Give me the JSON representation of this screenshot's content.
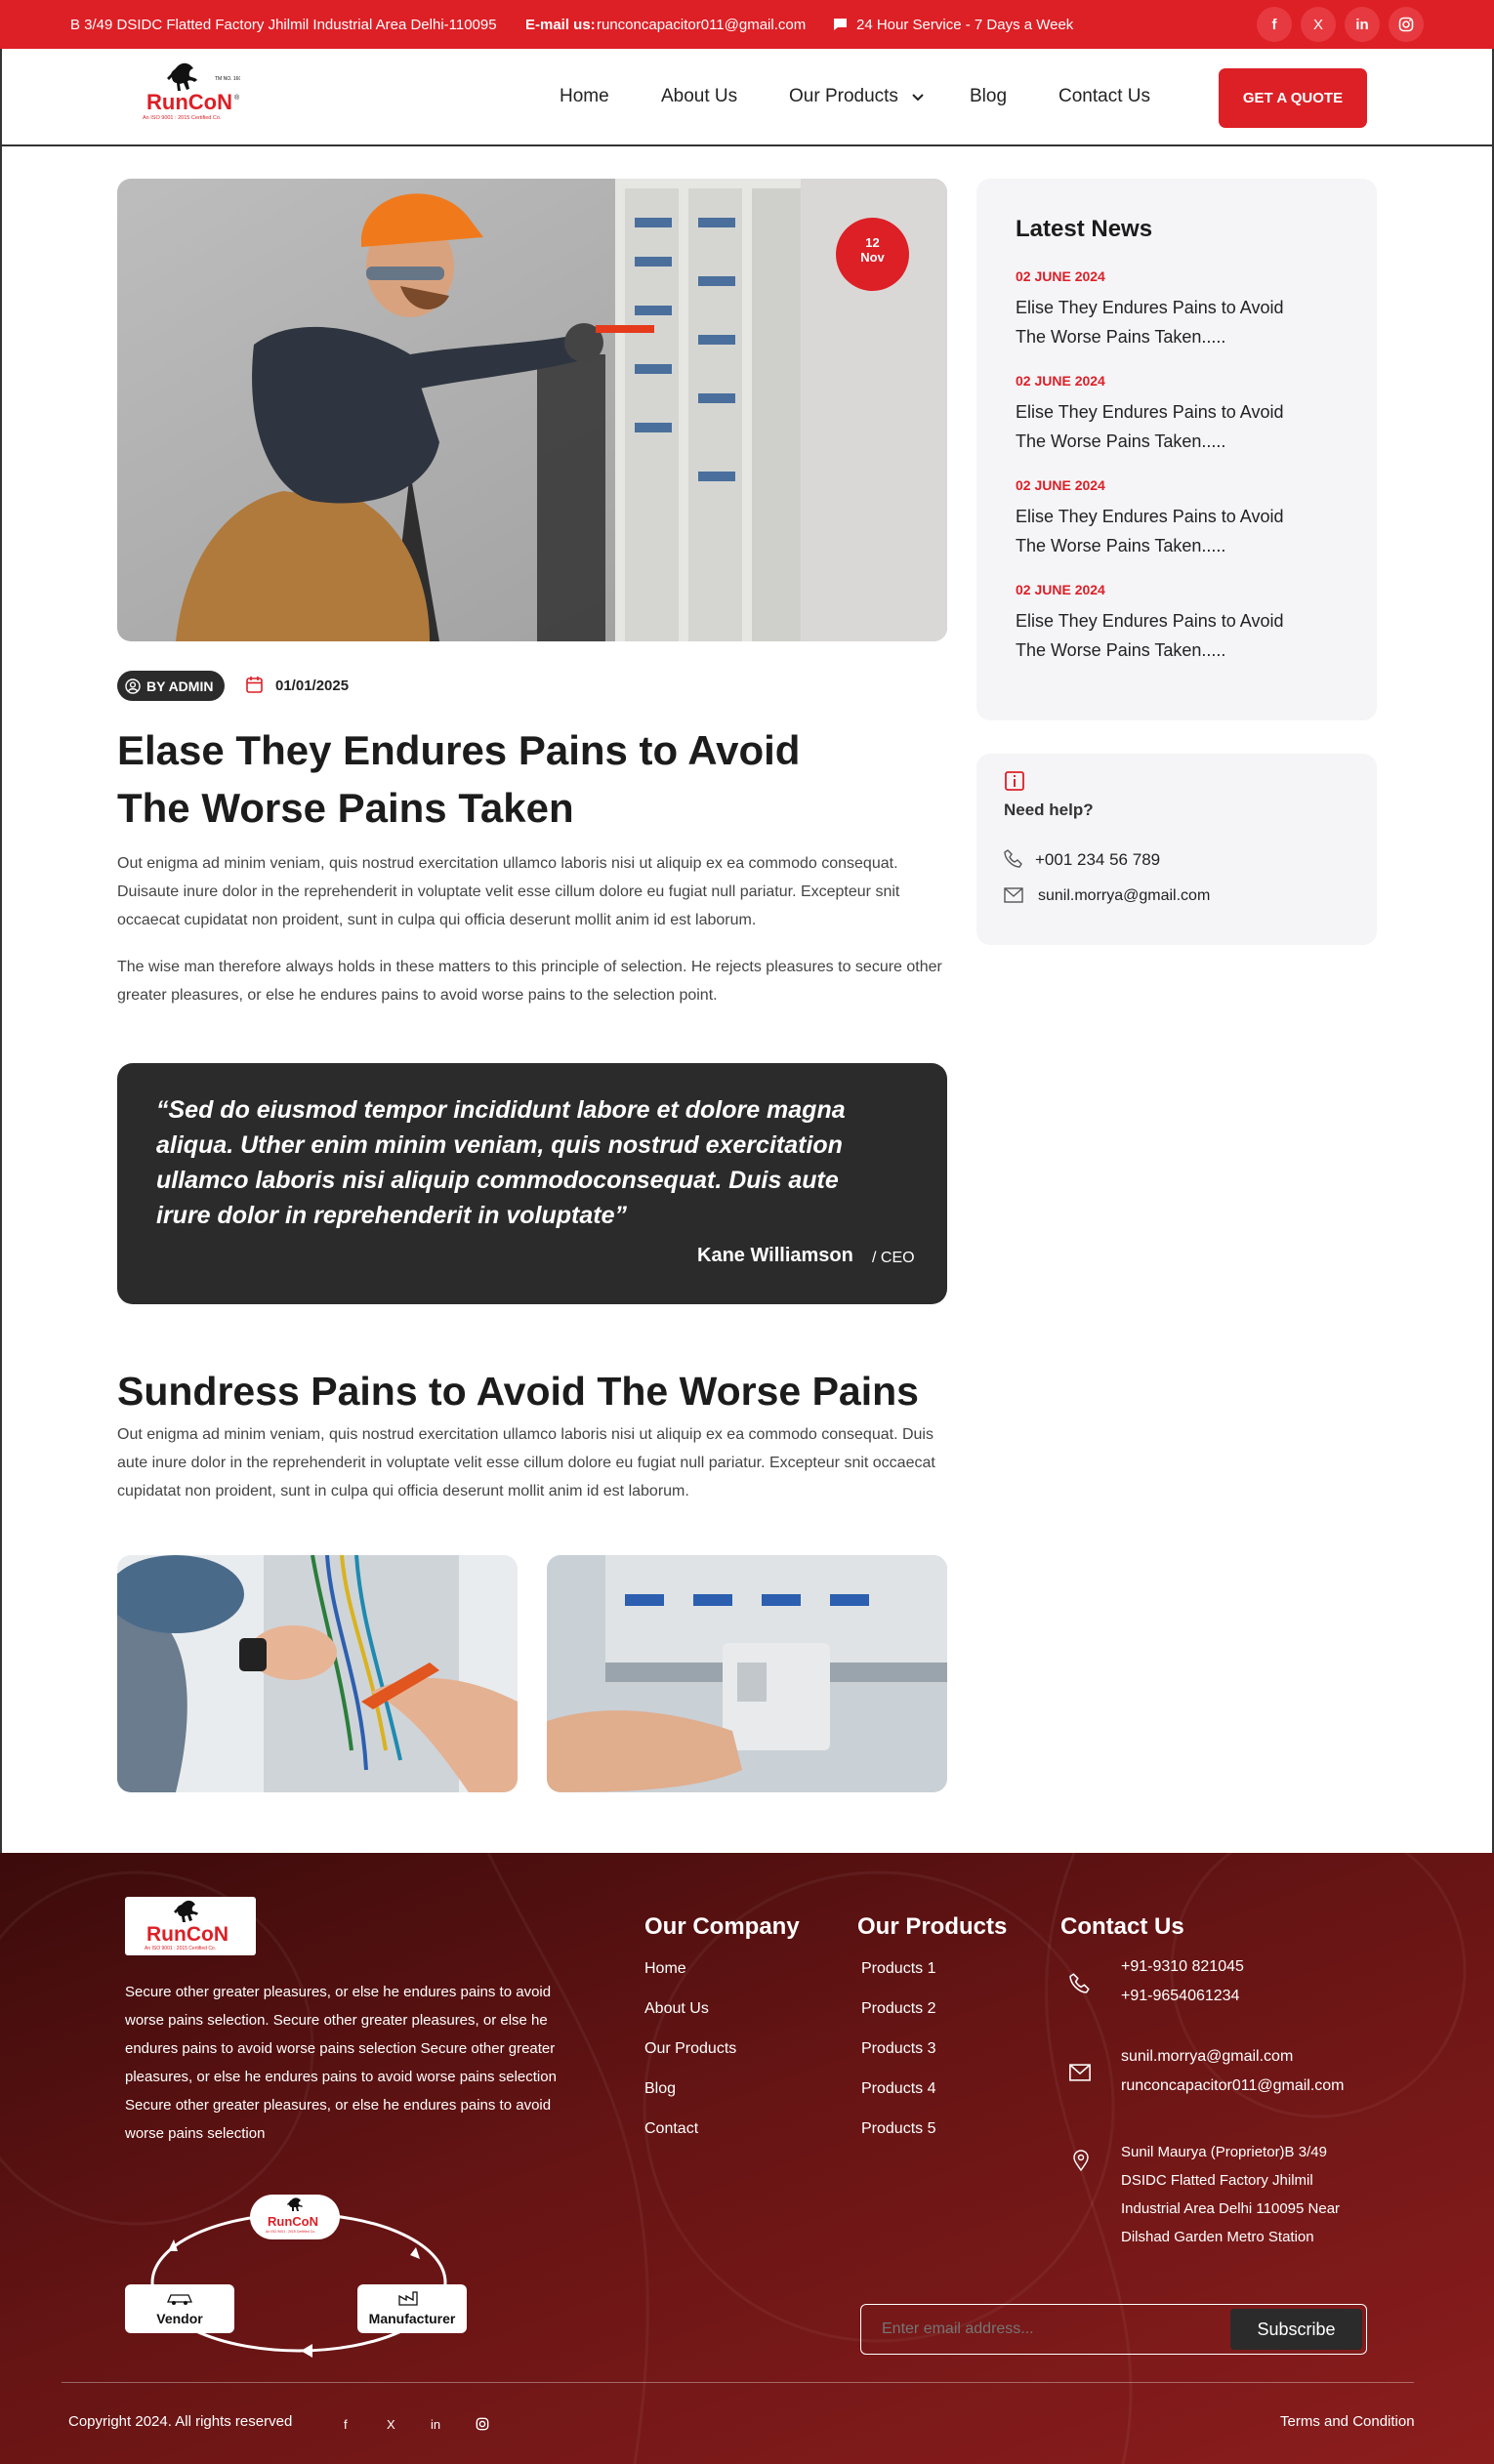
{
  "topbar": {
    "address": "B 3/49 DSIDC Flatted Factory Jhilmil Industrial Area Delhi-110095",
    "email_label": "E-mail us:",
    "email": "runconcapacitor011@gmail.com",
    "service": "24 Hour Service - 7 Days a Week",
    "social": [
      "f",
      "X",
      "in",
      "ig"
    ]
  },
  "brand": {
    "name": "RunCoN",
    "tagline": "TM NO. 1604826",
    "iso": "An ISO 9001 : 2015 Certified Co."
  },
  "nav": {
    "items": [
      "Home",
      "About Us",
      "Our Products",
      "Blog",
      "Contact Us"
    ],
    "cta": "GET A QUOTE"
  },
  "post": {
    "date_day": "12",
    "date_month": "Nov",
    "author": "BY ADMIN",
    "date": "01/01/2025",
    "title": "Elase They Endures Pains to Avoid The Worse Pains Taken",
    "para1": "Out enigma ad minim veniam, quis nostrud exercitation ullamco laboris nisi ut aliquip ex ea commodo consequat. Duisaute inure dolor in the reprehenderit in voluptate velit esse cillum dolore eu fugiat null pariatur. Excepteur snit occaecat cupidatat non proident, sunt in culpa qui officia deserunt mollit anim id est laborum.",
    "para2": "The wise man therefore always holds in these matters to this principle of selection. He rejects pleasures to secure other greater pleasures, or else he endures pains to avoid worse pains to the selection point.",
    "quote": "“Sed do eiusmod tempor incididunt labore et dolore magna aliqua. Uther enim minim veniam, quis nostrud exercitation ullamco laboris nisi aliquip commodoconsequat. Duis aute irure dolor in reprehenderit in voluptate”",
    "quote_author": "Kane Williamson",
    "quote_role": "/ CEO",
    "subtitle": "Sundress Pains to Avoid The Worse Pains",
    "para3": "Out enigma ad minim veniam, quis nostrud exercitation ullamco laboris nisi ut aliquip ex ea commodo consequat. Duis aute inure dolor in the reprehenderit in voluptate velit esse cillum dolore eu fugiat null pariatur. Excepteur snit occaecat cupidatat non proident, sunt in culpa qui officia deserunt mollit anim id est laborum."
  },
  "sidebar": {
    "news_title": "Latest News",
    "news": [
      {
        "date": "02 JUNE 2024",
        "title": "Elise They Endures Pains to Avoid The Worse Pains Taken....."
      },
      {
        "date": "02 JUNE 2024",
        "title": "Elise They Endures Pains to Avoid The Worse Pains Taken....."
      },
      {
        "date": "02 JUNE 2024",
        "title": "Elise They Endures Pains to Avoid The Worse Pains Taken....."
      },
      {
        "date": "02 JUNE 2024",
        "title": "Elise They Endures Pains to Avoid The Worse Pains Taken....."
      }
    ],
    "help_title": "Need help?",
    "phone": "+001 234 56 789",
    "email": "sunil.morrya@gmail.com"
  },
  "footer": {
    "about": "Secure other greater pleasures, or else he endures pains to avoid worse pains selection. Secure other greater pleasures, or else he endures pains to avoid worse pains selection Secure other greater pleasures, or else he endures pains to avoid worse pains selection Secure other greater pleasures, or else he endures pains to avoid worse pains selection",
    "diagram": {
      "vendor": "Vendor",
      "manufacturer": "Manufacturer"
    },
    "company_title": "Our Company",
    "company_links": [
      "Home",
      "About Us",
      "Our Products",
      "Blog",
      "Contact"
    ],
    "products_title": "Our Products",
    "product_links": [
      "Products 1",
      "Products 2",
      "Products 3",
      "Products 4",
      "Products 5"
    ],
    "contact_title": "Contact Us",
    "phone1": "+91-9310 821045",
    "phone2": "+91-9654061234",
    "email1": "sunil.morrya@gmail.com",
    "email2": "runconcapacitor011@gmail.com",
    "address": "Sunil Maurya (Proprietor)B 3/49 DSIDC Flatted Factory Jhilmil Industrial Area Delhi 110095 Near Dilshad Garden Metro Station",
    "subscribe_placeholder": "Enter email address...",
    "subscribe_button": "Subscribe",
    "copyright": "Copyright 2024. All rights reserved",
    "social": [
      "f",
      "X",
      "in",
      "ig"
    ],
    "terms": "Terms and Condition"
  },
  "colors": {
    "brand_red": "#dd1f26",
    "dark": "#2b2b2b",
    "footer_start": "#3c0b0b",
    "footer_end": "#8c1d1d"
  }
}
